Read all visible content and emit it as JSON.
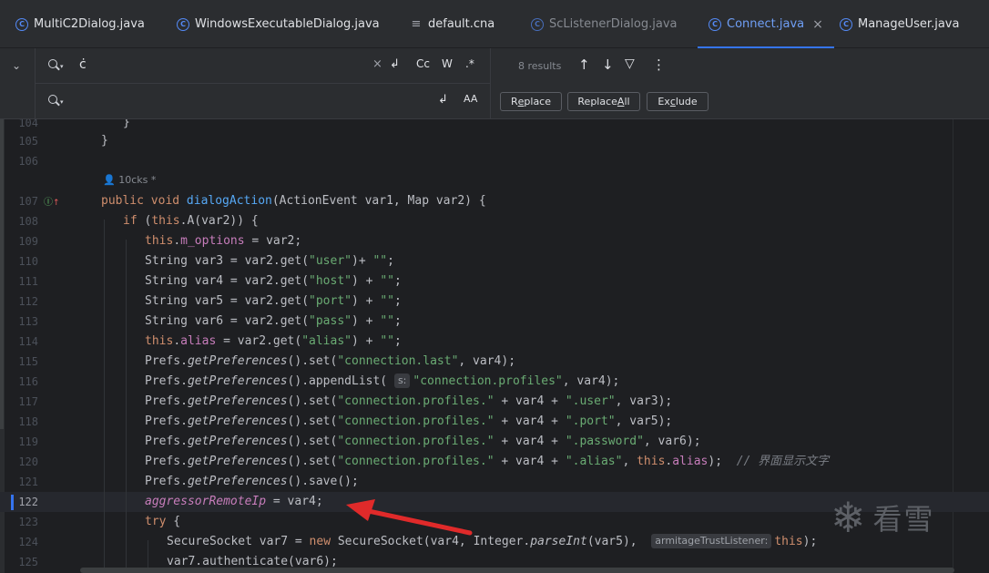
{
  "tabs": [
    {
      "label": "MultiC2Dialog.java",
      "kind": "class"
    },
    {
      "label": "WindowsExecutableDialog.java",
      "kind": "class"
    },
    {
      "label": "default.cna",
      "kind": "file"
    },
    {
      "label": "ScListenerDialog.java",
      "kind": "class"
    },
    {
      "label": "Connect.java",
      "kind": "class",
      "active": true
    },
    {
      "label": "ManageUser.java",
      "kind": "class"
    }
  ],
  "find": {
    "value": "ċ",
    "results": "8 results",
    "match_case": "Cc",
    "words": "W",
    "regex": ".*"
  },
  "replace": {
    "value": "",
    "preserve_case": "AA",
    "replace_button": "Replace",
    "replace_all_button": "Replace All",
    "exclude_button": "Exclude"
  },
  "editor": {
    "author_hint": "10cks *",
    "current_line": "122",
    "lines": [
      {
        "n": "104",
        "code": "}"
      },
      {
        "n": "105",
        "code": "}"
      },
      {
        "n": "106",
        "code": ""
      },
      {
        "n": "107",
        "code": "public void dialogAction(ActionEvent var1, Map var2) {"
      },
      {
        "n": "108",
        "code": "if (this.A(var2)) {"
      },
      {
        "n": "109",
        "code": "this.m_options = var2;"
      },
      {
        "n": "110",
        "code": "String var3 = var2.get(\"user\")+ \"\";"
      },
      {
        "n": "111",
        "code": "String var4 = var2.get(\"host\") + \"\";"
      },
      {
        "n": "112",
        "code": "String var5 = var2.get(\"port\") + \"\";"
      },
      {
        "n": "113",
        "code": "String var6 = var2.get(\"pass\") + \"\";"
      },
      {
        "n": "114",
        "code": "this.alias = var2.get(\"alias\") + \"\";"
      },
      {
        "n": "115",
        "code": "Prefs.getPreferences().set(\"connection.last\", var4);"
      },
      {
        "n": "116",
        "code": "Prefs.getPreferences().appendList( s: \"connection.profiles\", var4);"
      },
      {
        "n": "117",
        "code": "Prefs.getPreferences().set(\"connection.profiles.\" + var4 + \".user\", var3);"
      },
      {
        "n": "118",
        "code": "Prefs.getPreferences().set(\"connection.profiles.\" + var4 + \".port\", var5);"
      },
      {
        "n": "119",
        "code": "Prefs.getPreferences().set(\"connection.profiles.\" + var4 + \".password\", var6);"
      },
      {
        "n": "120",
        "code": "Prefs.getPreferences().set(\"connection.profiles.\" + var4 + \".alias\", this.alias);  // 界面显示文字"
      },
      {
        "n": "121",
        "code": "Prefs.getPreferences().save();"
      },
      {
        "n": "122",
        "code": "aggressorRemoteIp = var4;"
      },
      {
        "n": "123",
        "code": "try {"
      },
      {
        "n": "124",
        "code": "SecureSocket var7 = new SecureSocket(var4, Integer.parseInt(var5),  armitageTrustListener: this);"
      },
      {
        "n": "125",
        "code": "var7.authenticate(var6);"
      }
    ],
    "parts": {
      "l107_kw": "public void ",
      "l107_fn": "dialogAction",
      "l107_rest": "(ActionEvent var1, Map var2) {",
      "l108_kw1": "if ",
      "l108_p": "(",
      "l108_kw2": "this",
      "l108_rest": ".A(var2)) {",
      "this": "this",
      "m_options": "m_options",
      "eq_var2": " = var2;",
      "string_decl": "String ",
      "var3_get": "var3 = var2.get(",
      "var4_get": "var4 = var2.get(",
      "var5_get": "var5 = var2.get(",
      "var6_get": "var6 = var2.get(",
      "s_user": "\"user\"",
      "s_host": "\"host\"",
      "s_port": "\"port\"",
      "s_pass": "\"pass\"",
      "s_alias": "\"alias\"",
      "s_empty": "\"\"",
      "plus_nospace": ")+ ",
      "plus": ") + ",
      "semi": ";",
      "dot": ".",
      "alias": "alias",
      "alias_get": " = var2.get(",
      "prefs": "Prefs.",
      "getPreferences": "getPreferences",
      "set_open": "().set(",
      "append_open": "().appendList(",
      "save_call": "().save();",
      "s_conn_last": "\"connection.last\"",
      "s_conn_profiles": "\"connection.profiles\"",
      "s_conn_profiles_dot": "\"connection.profiles.\"",
      "plus_var4_plus": " + var4 + ",
      "s_user_sfx": "\".user\"",
      "s_port_sfx": "\".port\"",
      "s_password_sfx": "\".password\"",
      "s_alias_sfx": "\".alias\"",
      "comma_var4_end": ", var4);",
      "comma_var3_end": ", var3);",
      "comma_var5_end": ", var5);",
      "comma_var6_end": ", var6);",
      "comma_sp": ", ",
      "alias_end": ");  ",
      "comment": "// 界面显示文字",
      "hint_s": "s:",
      "aggr": "aggressorRemoteIp",
      "aggr_rest": " = var4;",
      "try": "try",
      "brace": " {",
      "l124_a": "SecureSocket var7 = ",
      "new": "new",
      "l124_b": " SecureSocket(var4, Integer.",
      "parseInt": "parseInt",
      "l124_c": "(var5), ",
      "hint_trust": "armitageTrustListener:",
      "l124_end": ");",
      "l125": "var7.authenticate(var6);",
      "close_brace": "}"
    }
  },
  "watermark": {
    "text": "看雪"
  }
}
